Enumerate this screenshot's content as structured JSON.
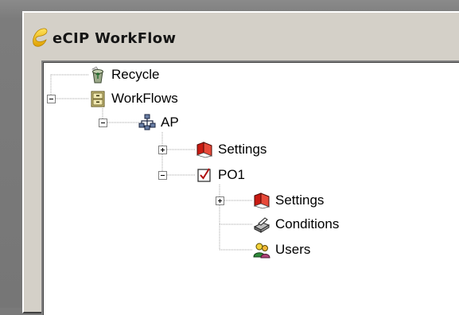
{
  "window": {
    "title": "eCIP WorkFlow"
  },
  "tree": {
    "nodes": [
      {
        "label": "Recycle",
        "icon": "recycle-bin-icon",
        "expander": "none"
      },
      {
        "label": "WorkFlows",
        "icon": "file-cabinet-icon",
        "expander": "expanded"
      },
      {
        "label": "AP",
        "icon": "network-icon",
        "expander": "expanded"
      },
      {
        "label": "Settings",
        "icon": "settings-book-icon",
        "expander": "collapsed"
      },
      {
        "label": "PO1",
        "icon": "checkbox-icon",
        "expander": "expanded"
      },
      {
        "label": "Settings",
        "icon": "settings-book-icon",
        "expander": "collapsed"
      },
      {
        "label": "Conditions",
        "icon": "conditions-icon",
        "expander": "none"
      },
      {
        "label": "Users",
        "icon": "users-icon",
        "expander": "none"
      }
    ]
  }
}
